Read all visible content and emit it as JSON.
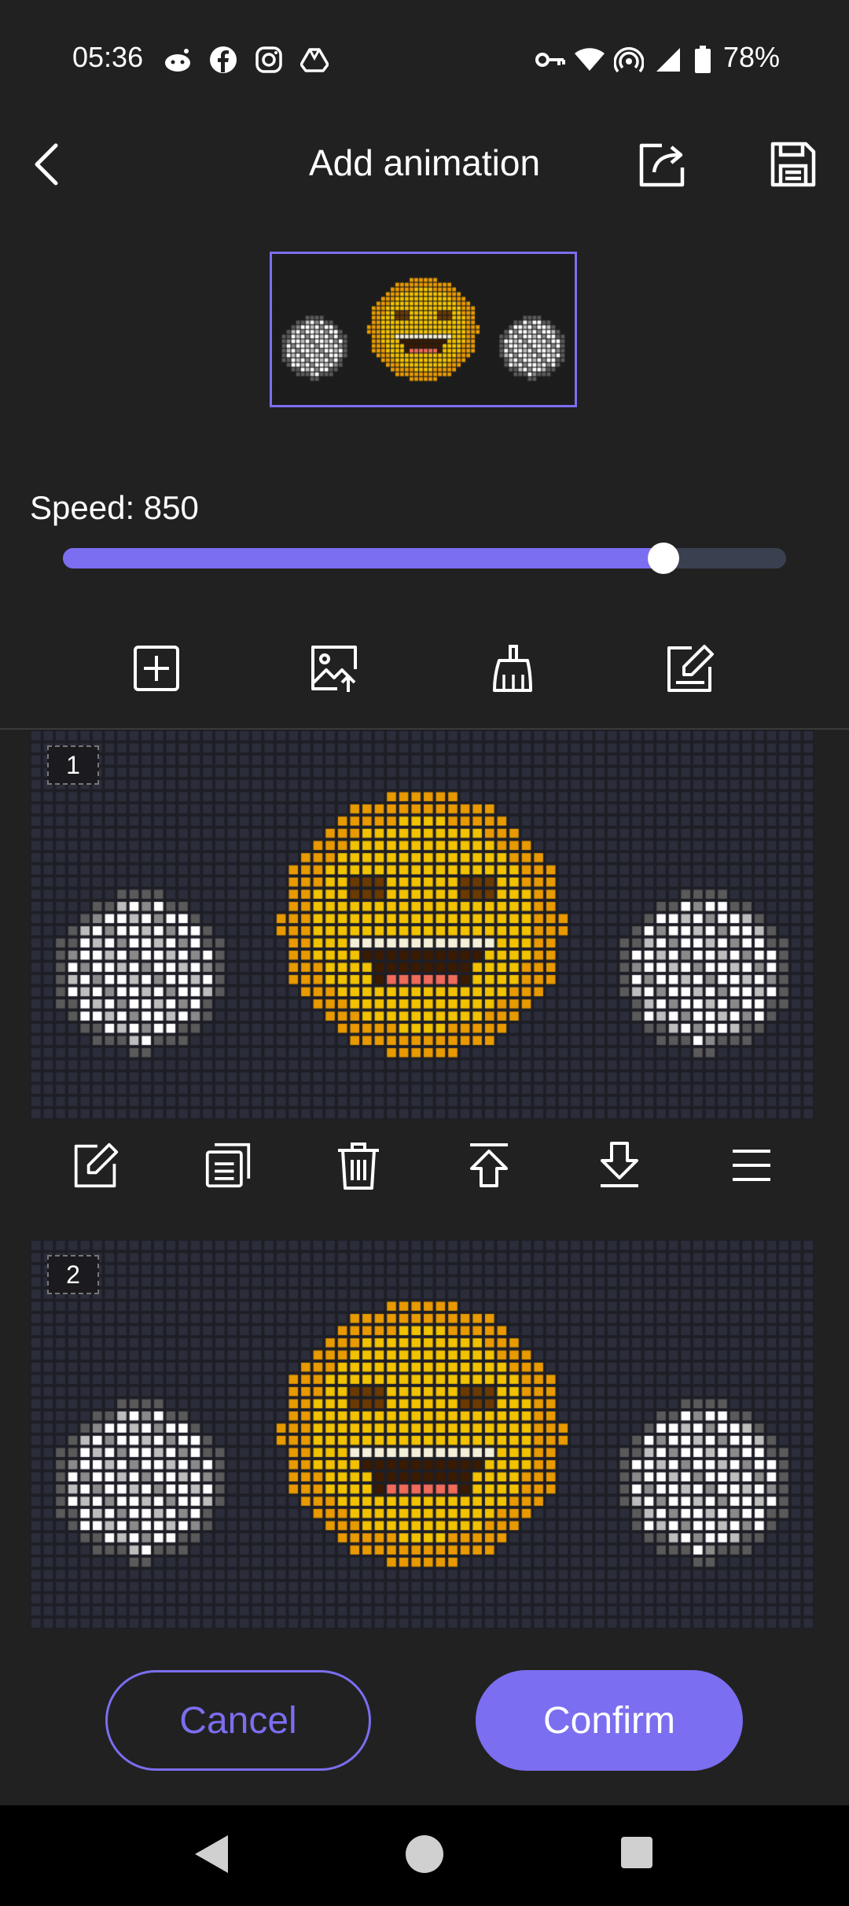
{
  "status_bar": {
    "time": "05:36",
    "battery": "78%",
    "left_icons": [
      "reddit-icon",
      "facebook-icon",
      "instagram-icon",
      "drive-icon"
    ],
    "right_icons": [
      "key-icon",
      "wifi-icon",
      "hotspot-icon",
      "signal-icon",
      "battery-icon"
    ]
  },
  "header": {
    "title": "Add animation",
    "back_icon": "back-arrow-icon",
    "share_icon": "share-icon",
    "save_icon": "save-icon"
  },
  "speed": {
    "label": "Speed: 850",
    "value": 850,
    "fraction": 0.83
  },
  "toolbar": [
    "add-frame-icon",
    "import-image-icon",
    "clear-broom-icon",
    "edit-icon"
  ],
  "frames": [
    {
      "number": "1"
    },
    {
      "number": "2"
    }
  ],
  "frame_tools": [
    "edit-icon",
    "duplicate-icon",
    "delete-icon",
    "move-up-icon",
    "move-down-icon",
    "menu-icon"
  ],
  "buttons": {
    "cancel": "Cancel",
    "confirm": "Confirm"
  },
  "colors": {
    "accent": "#7b6ef0",
    "background": "#212121",
    "emoji_yellow": "#f2c200",
    "emoji_orange": "#e89a00",
    "tongue": "#f06b5a"
  }
}
